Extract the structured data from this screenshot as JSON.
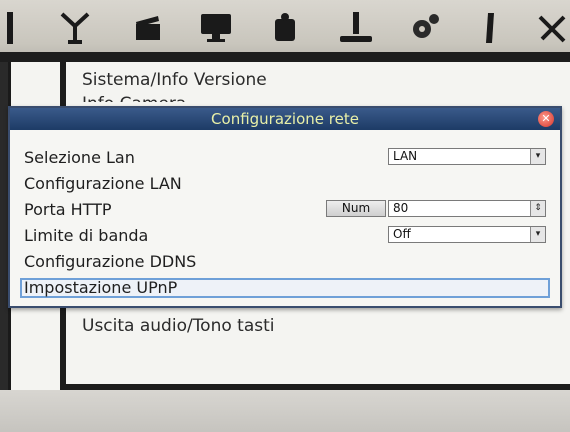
{
  "toolbar": {
    "icons": [
      {
        "name": "antenna-icon",
        "glyph": "⚲"
      },
      {
        "name": "clapperboard-icon",
        "glyph": "🎬"
      },
      {
        "name": "monitor-icon",
        "glyph": "🖥"
      },
      {
        "name": "camera-icon",
        "glyph": "📷"
      },
      {
        "name": "hard-disk-icon",
        "glyph": "⏏"
      },
      {
        "name": "settings-gear-icon",
        "glyph": "⚙"
      },
      {
        "name": "usb-icon",
        "glyph": "🔌"
      },
      {
        "name": "tools-icon",
        "glyph": "✕"
      }
    ]
  },
  "background_menu": {
    "items": [
      "Sistema/Info Versione",
      "Info Camera",
      "Uscita audio/Tono tasti"
    ]
  },
  "dialog": {
    "title": "Configurazione rete",
    "rows": {
      "lan_select_label": "Selezione Lan",
      "lan_select_value": "LAN",
      "lan_config_label": "Configurazione LAN",
      "http_port_label": "Porta HTTP",
      "http_port_button": "Num",
      "http_port_value": "80",
      "bandwidth_label": "Limite di banda",
      "bandwidth_value": "Off",
      "ddns_label": "Configurazione DDNS",
      "upnp_label": "Impostazione UPnP"
    }
  },
  "colors": {
    "titlebar": "#1d3b66",
    "title_text": "#e9f0a8",
    "selection_border": "#6fa0d8"
  }
}
